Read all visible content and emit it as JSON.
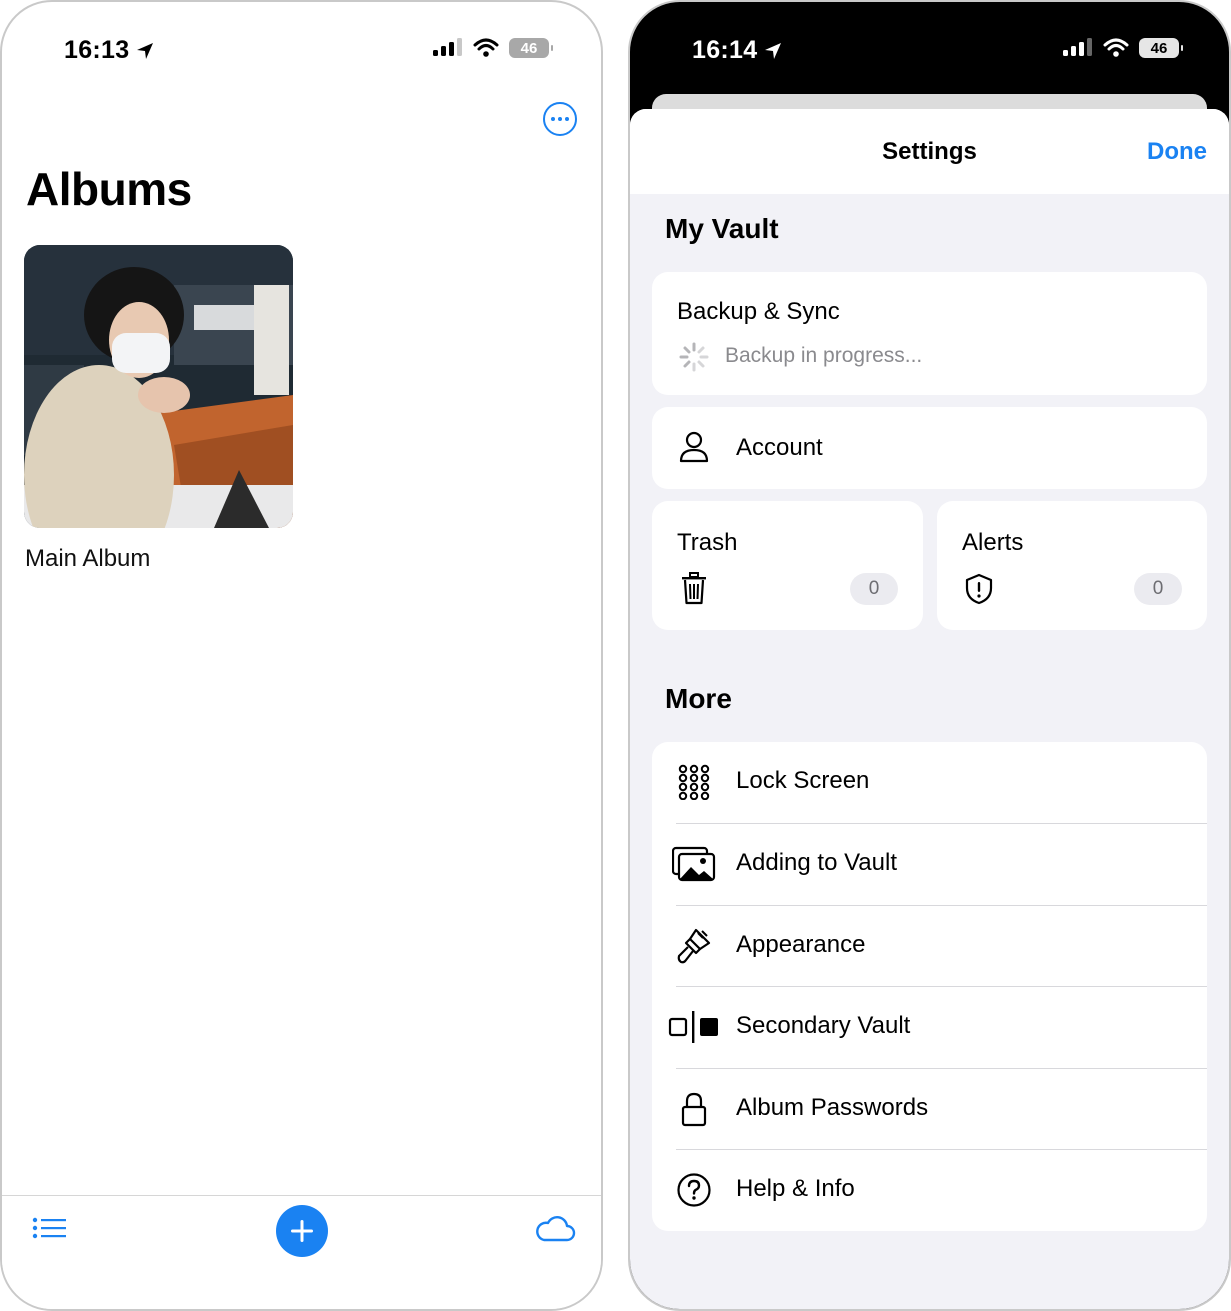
{
  "left_screen": {
    "status_bar": {
      "time": "16:13",
      "battery": "46"
    },
    "title": "Albums",
    "album": {
      "name": "Main Album"
    },
    "icons": {
      "more": "ellipsis-circle-icon",
      "list": "list-icon",
      "add": "plus-circle-icon",
      "cloud": "cloud-icon"
    }
  },
  "right_screen": {
    "status_bar": {
      "time": "16:14",
      "battery": "46"
    },
    "header": {
      "title": "Settings",
      "done_label": "Done"
    },
    "my_vault": {
      "heading": "My Vault",
      "backup": {
        "label": "Backup & Sync",
        "status": "Backup in progress..."
      },
      "account": {
        "label": "Account"
      },
      "trash": {
        "label": "Trash",
        "count": "0"
      },
      "alerts": {
        "label": "Alerts",
        "count": "0"
      }
    },
    "more": {
      "heading": "More",
      "items": [
        {
          "label": "Lock Screen",
          "icon": "keypad-icon"
        },
        {
          "label": "Adding to Vault",
          "icon": "photos-icon"
        },
        {
          "label": "Appearance",
          "icon": "paintbrush-icon"
        },
        {
          "label": "Secondary Vault",
          "icon": "split-vault-icon"
        },
        {
          "label": "Album Passwords",
          "icon": "lock-icon"
        },
        {
          "label": "Help & Info",
          "icon": "question-circle-icon"
        }
      ]
    }
  },
  "colors": {
    "accent": "#1a82f2",
    "grouped_background": "#f2f2f7",
    "secondary_text": "#8a8a8e"
  }
}
